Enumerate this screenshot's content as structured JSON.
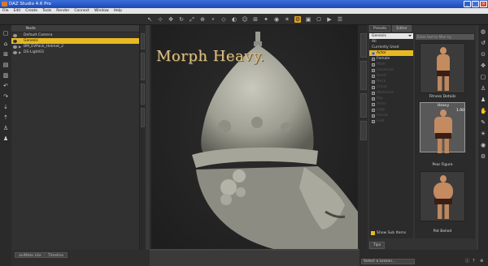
{
  "window": {
    "title": "DAZ Studio 4.6 Pro"
  },
  "menu": [
    "File",
    "Edit",
    "Create",
    "Tools",
    "Render",
    "Connect",
    "Window",
    "Help"
  ],
  "scene": {
    "header": "Node",
    "rows": [
      {
        "label": "Default Camera",
        "selected": false
      },
      {
        "label": "Genesis",
        "selected": true
      },
      {
        "label": "BM_EVPack_Helmet_2",
        "selected": false
      },
      {
        "label": "DS-Light03",
        "selected": false
      }
    ]
  },
  "bottom_tabs": [
    "aniMate Lite",
    "Timeline"
  ],
  "viewport": {
    "overlay_title": "Morph Heavy."
  },
  "content": {
    "tabs": [
      "Presets",
      "Editor"
    ],
    "dropdown": "Genesis",
    "categories": [
      {
        "label": "All",
        "state": "normal"
      },
      {
        "label": "Currently Used",
        "state": "normal"
      },
      {
        "label": "Actor",
        "state": "active"
      },
      {
        "label": "Female",
        "state": "normal"
      },
      {
        "label": "Male",
        "state": "faded"
      },
      {
        "label": "Universal",
        "state": "faded"
      },
      {
        "label": "Head",
        "state": "faded"
      },
      {
        "label": "Neck",
        "state": "faded"
      },
      {
        "label": "Chest",
        "state": "faded"
      },
      {
        "label": "Abdomen",
        "state": "faded"
      },
      {
        "label": "Hip",
        "state": "faded"
      },
      {
        "label": "Arms",
        "state": "faded"
      },
      {
        "label": "Legs",
        "state": "faded"
      },
      {
        "label": "Hands",
        "state": "faded"
      },
      {
        "label": "Feet",
        "state": "faded"
      }
    ],
    "show_sub_items": "Show Sub Items",
    "search_placeholder": "Enter text to filter by",
    "thumbs": [
      {
        "label": "Fitness Details",
        "value": "",
        "selected": false
      },
      {
        "label": "Heavy",
        "value": "1.00",
        "selected": true
      },
      {
        "label": "Pear Figure",
        "value": "",
        "selected": false
      },
      {
        "label": "Pot Belied",
        "value": "",
        "selected": false
      }
    ],
    "footer_tab": "Tips"
  },
  "status": {
    "lesson_placeholder": "Select a Lesson..."
  },
  "colors": {
    "accent": "#e8b922",
    "titlebar": "#2a58c8",
    "overlay_text": "#d9c08a"
  }
}
